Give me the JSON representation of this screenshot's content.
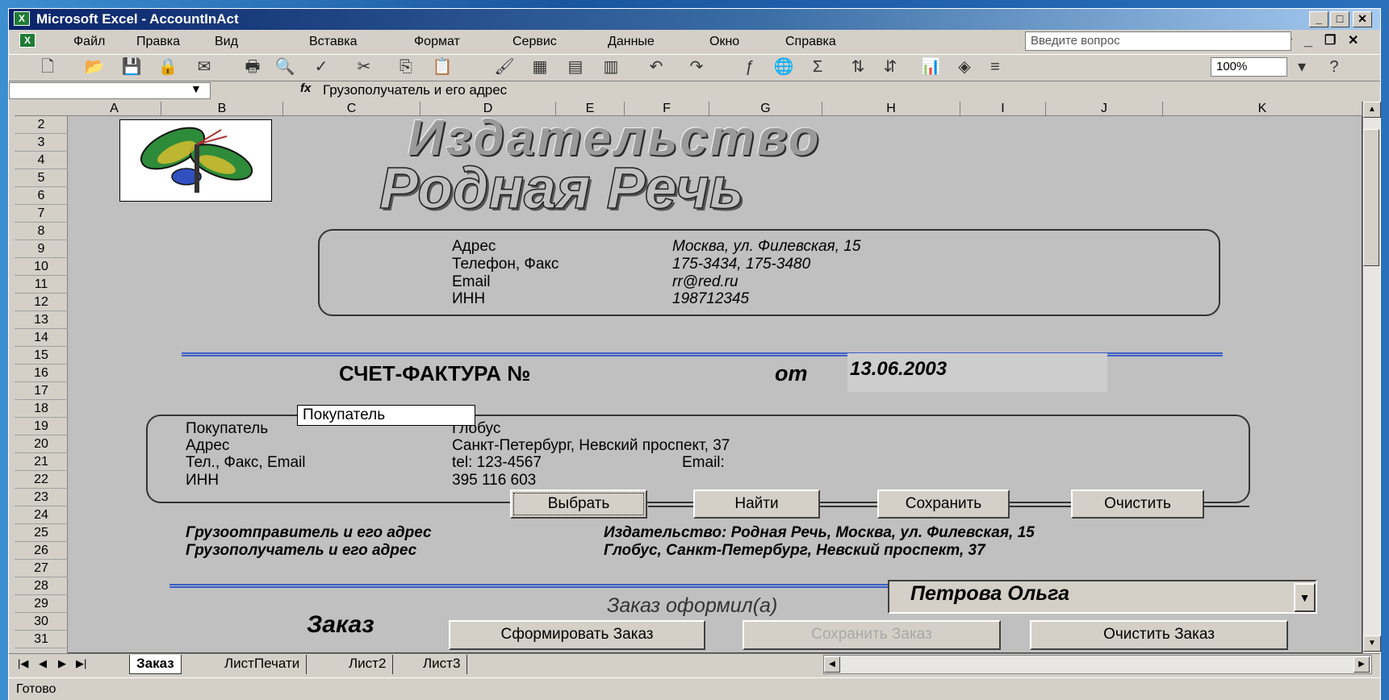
{
  "window": {
    "title": "Microsoft Excel - AccountInAct",
    "app_icon": "excel-icon"
  },
  "menu": [
    "Файл",
    "Правка",
    "Вид",
    "Вставка",
    "Формат",
    "Сервис",
    "Данные",
    "Окно",
    "Справка"
  ],
  "ask_placeholder": "Введите вопрос",
  "zoom": "100%",
  "formula": {
    "fx": "fx",
    "value": "Грузополучатель и его адрес",
    "name_box": ""
  },
  "columns": [
    "A",
    "B",
    "C",
    "D",
    "E",
    "F",
    "G",
    "H",
    "I",
    "J",
    "K"
  ],
  "rows": [
    "2",
    "3",
    "4",
    "5",
    "6",
    "7",
    "8",
    "9",
    "10",
    "11",
    "12",
    "13",
    "14",
    "15",
    "16",
    "17",
    "18",
    "19",
    "20",
    "21",
    "22",
    "23",
    "24",
    "25",
    "26",
    "27",
    "28",
    "29",
    "30",
    "31"
  ],
  "heading": {
    "line1": "Издательство",
    "line2": "Родная Речь"
  },
  "publisher": {
    "labels": [
      "Адрес",
      "Телефон, Факс",
      "Email",
      "ИНН"
    ],
    "values": [
      "Москва, ул. Филевская, 15",
      "175-3434, 175-3480",
      "rr@red.ru",
      "198712345"
    ]
  },
  "invoice": {
    "title": "СЧЕТ-ФАКТУРА №",
    "from": "от",
    "date": "13.06.2003"
  },
  "buyer": {
    "tooltip": "Покупатель",
    "labels": [
      "Покупатель",
      "Адрес",
      "Тел., Факс, Email",
      "ИНН"
    ],
    "name": "Глобус",
    "address": "Санкт-Петербург, Невский проспект, 37",
    "phone": "tel:  123-4567",
    "email_label": "Email:",
    "inn": "395 116 603",
    "buttons": [
      "Выбрать",
      "Найти",
      "Сохранить",
      "Очистить"
    ]
  },
  "shipping": {
    "sender_label": "Грузоотправитель и его адрес",
    "sender_value": "Издательство: Родная Речь, Москва, ул. Филевская, 15",
    "receiver_label": "Грузополучатель и его адрес",
    "receiver_value": "Глобус, Санкт-Петербург, Невский проспект, 37"
  },
  "order": {
    "manager_label": "Заказ оформил(а)",
    "manager": "Петрова Ольга",
    "title": "Заказ",
    "buttons": [
      "Сформировать Заказ",
      "Сохранить Заказ",
      "Очистить Заказ"
    ]
  },
  "sheets": [
    "Заказ",
    "ЛистПечати",
    "Лист2",
    "Лист3"
  ],
  "status": "Готово"
}
